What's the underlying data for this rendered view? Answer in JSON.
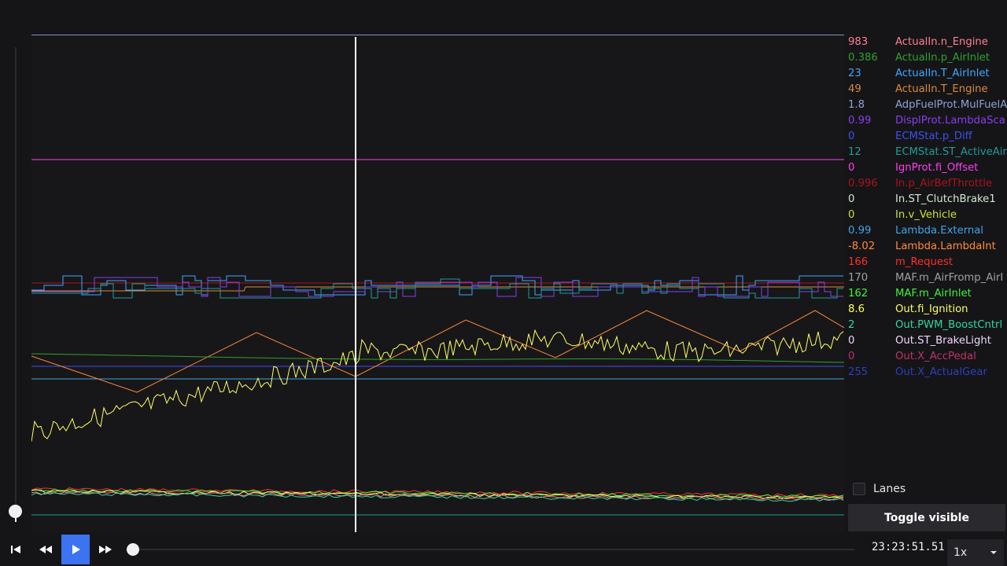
{
  "legend": [
    {
      "value": "983",
      "name": "ActualIn.n_Engine",
      "color": "#ff7f91"
    },
    {
      "value": "0.386",
      "name": "ActualIn.p_AirInlet",
      "color": "#2fa02f"
    },
    {
      "value": "23",
      "name": "ActualIn.T_AirInlet",
      "color": "#3ea7ff"
    },
    {
      "value": "49",
      "name": "ActualIn.T_Engine",
      "color": "#d98a3c"
    },
    {
      "value": "1.8",
      "name": "AdpFuelProt.MulFuelA",
      "color": "#8fa0d8"
    },
    {
      "value": "0.99",
      "name": "DisplProt.LambdaSca",
      "color": "#8a3cf0"
    },
    {
      "value": "0",
      "name": "ECMStat.p_Diff",
      "color": "#3c4ff0"
    },
    {
      "value": "12",
      "name": "ECMStat.ST_ActiveAirl",
      "color": "#1f9c96"
    },
    {
      "value": "0",
      "name": "IgnProt.fi_Offset",
      "color": "#ff3df0"
    },
    {
      "value": "0.996",
      "name": "In.p_AirBefThrottle",
      "color": "#a8141c"
    },
    {
      "value": "0",
      "name": "In.ST_ClutchBrake1",
      "color": "#d3e8d3"
    },
    {
      "value": "0",
      "name": "In.v_Vehicle",
      "color": "#c7e03a"
    },
    {
      "value": "0.99",
      "name": "Lambda.External",
      "color": "#3fa4e8"
    },
    {
      "value": "-8.02",
      "name": "Lambda.LambdaInt",
      "color": "#ff8a3a"
    },
    {
      "value": "166",
      "name": "m_Request",
      "color": "#ff2d2d"
    },
    {
      "value": "170",
      "name": "MAF.m_AirFromp_AirI",
      "color": "#a0a0a0"
    },
    {
      "value": "162",
      "name": "MAF.m_AirInlet",
      "color": "#3ef03e"
    },
    {
      "value": "8.6",
      "name": "Out.fi_Ignition",
      "color": "#ffff66"
    },
    {
      "value": "2",
      "name": "Out.PWM_BoostCntrl",
      "color": "#33d6a0"
    },
    {
      "value": "0",
      "name": "Out.ST_BrakeLight",
      "color": "#f0d6ff"
    },
    {
      "value": "0",
      "name": "Out.X_AccPedal",
      "color": "#c0306a"
    },
    {
      "value": "255",
      "name": "Out.X_ActualGear",
      "color": "#2d3fc0"
    }
  ],
  "lanes": {
    "label": "Lanes",
    "checked": false
  },
  "toggle_visible_label": "Toggle visible",
  "playback": {
    "time": "23:23:51.51",
    "speed": "1x",
    "first_icon": "skip-to-start-icon",
    "rewind_icon": "rewind-icon",
    "play_icon": "play-icon",
    "forward_icon": "fast-forward-icon"
  },
  "colors": {
    "accent": "#3b73f0",
    "background": "#151517",
    "cursor": "#ffffff"
  }
}
